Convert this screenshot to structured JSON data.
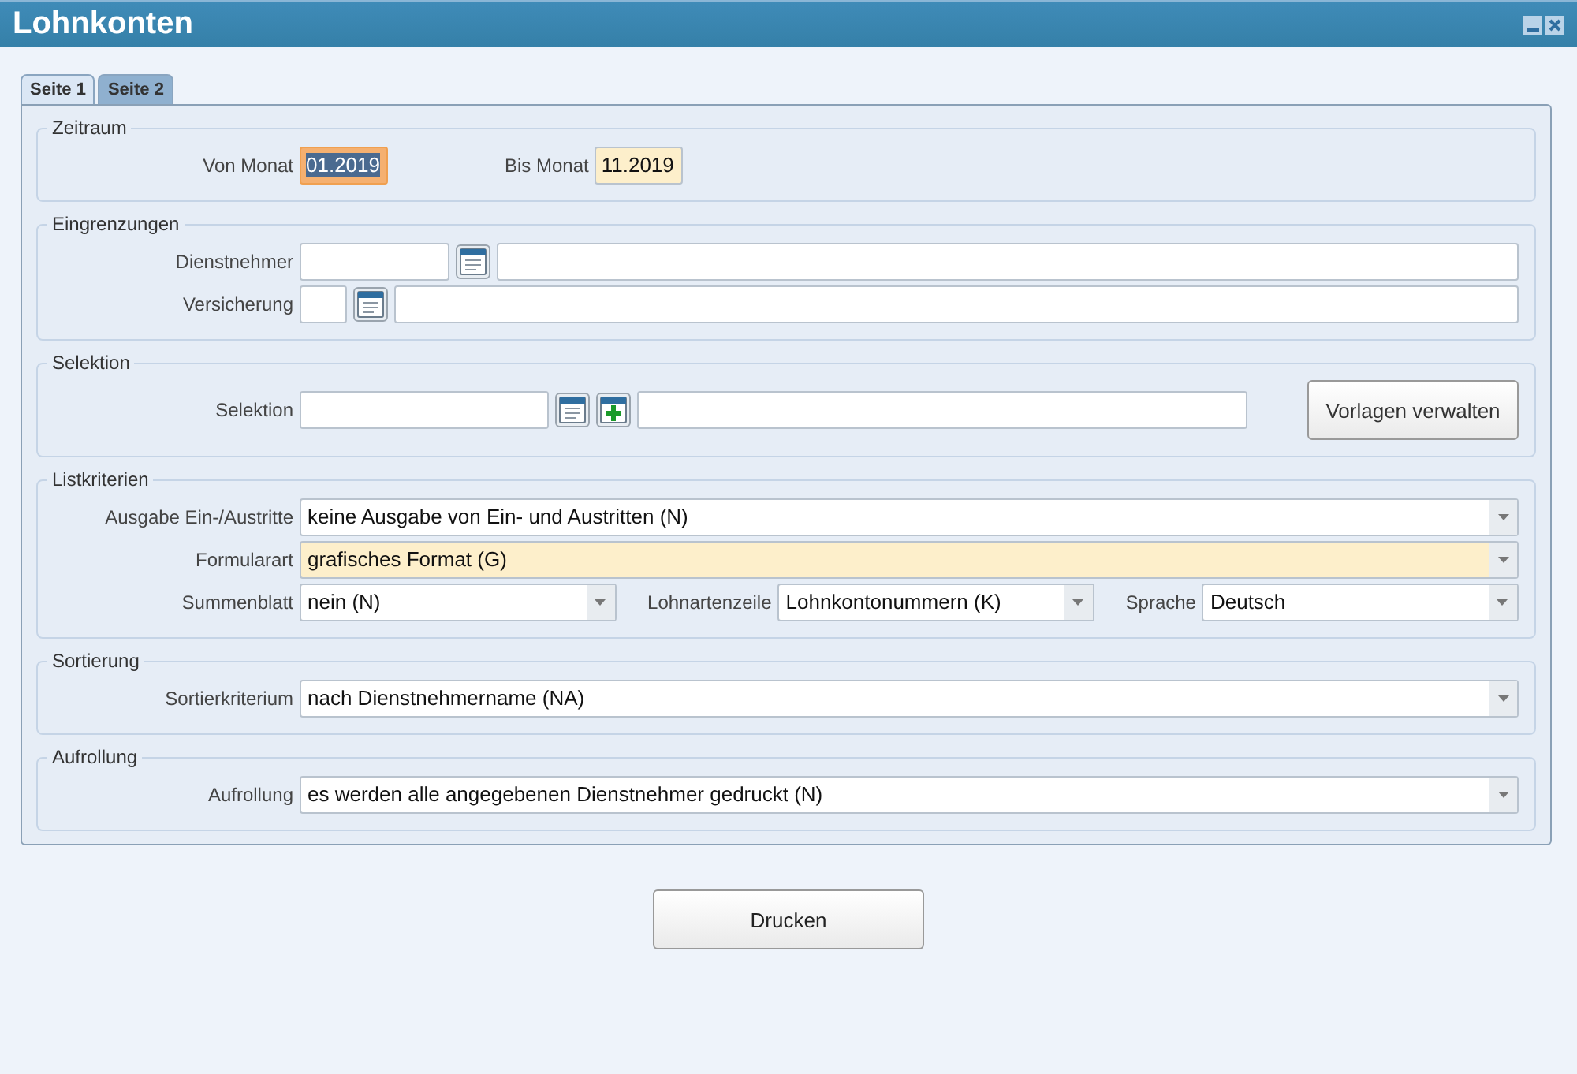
{
  "window": {
    "title": "Lohnkonten"
  },
  "tabs": [
    {
      "label": "Seite 1",
      "selected": true
    },
    {
      "label": "Seite 2",
      "selected": false
    }
  ],
  "sections": [
    {
      "title": "Zeitraum",
      "rows": [
        [
          {
            "kind": "label",
            "text": "Von Monat"
          },
          {
            "kind": "month-input",
            "value": "01.2019",
            "focused": true,
            "highlighted": false
          },
          {
            "kind": "inline-label",
            "text": "Bis Monat"
          },
          {
            "kind": "month-input",
            "value": "11.2019",
            "focused": false,
            "highlighted": true
          }
        ]
      ]
    },
    {
      "title": "Eingrenzungen",
      "rows": [
        [
          {
            "kind": "label",
            "text": "Dienstnehmer"
          },
          {
            "kind": "code-input",
            "focused": false,
            "highlighted": false
          },
          {
            "kind": "list-button"
          },
          {
            "kind": "name-input",
            "focused": false,
            "highlighted": false
          }
        ],
        [
          {
            "kind": "label",
            "text": "Versicherung"
          },
          {
            "kind": "key-input",
            "focused": false,
            "highlighted": false
          },
          {
            "kind": "list-button"
          },
          {
            "kind": "name-input",
            "focused": false,
            "highlighted": false
          }
        ]
      ]
    },
    {
      "title": "Selektion",
      "rows": [
        [
          {
            "kind": "label",
            "text": "Selektion"
          },
          {
            "kind": "selection-input",
            "focused": false,
            "highlighted": false
          },
          {
            "kind": "list-button"
          },
          {
            "kind": "add-button"
          },
          {
            "kind": "wide-input",
            "focused": false,
            "highlighted": false
          },
          {
            "kind": "button",
            "text": "Vorlagen verwalten"
          }
        ]
      ]
    },
    {
      "title": "Listkriterien",
      "rows": [
        [
          {
            "kind": "label",
            "text": "Ausgabe Ein-/Austritte"
          },
          {
            "kind": "dropdown",
            "value": "keine Ausgabe von Ein- und Austritten (N)",
            "focused": false,
            "highlighted": false
          }
        ],
        [
          {
            "kind": "label",
            "text": "Formularart"
          },
          {
            "kind": "dropdown",
            "value": "grafisches Format (G)",
            "focused": false,
            "highlighted": true
          }
        ],
        [
          {
            "kind": "label",
            "text": "Summenblatt"
          },
          {
            "kind": "dropdown",
            "value": "nein (N)",
            "focused": false,
            "highlighted": false
          },
          {
            "kind": "inline-label",
            "text": "Lohnartenzeile"
          },
          {
            "kind": "dropdown",
            "value": "Lohnkontonummern (K)",
            "focused": false,
            "highlighted": false
          },
          {
            "kind": "inline-label",
            "text": "Sprache"
          },
          {
            "kind": "dropdown",
            "value": "Deutsch",
            "focused": false,
            "highlighted": false
          }
        ]
      ]
    },
    {
      "title": "Sortierung",
      "rows": [
        [
          {
            "kind": "label",
            "text": "Sortierkriterium"
          },
          {
            "kind": "dropdown",
            "value": "nach Dienstnehmername (NA)",
            "focused": false,
            "highlighted": false
          }
        ]
      ]
    },
    {
      "title": "Aufrollung",
      "rows": [
        [
          {
            "kind": "label",
            "text": "Aufrollung"
          },
          {
            "kind": "dropdown",
            "value": "es werden alle angegebenen Dienstnehmer gedruckt (N)",
            "focused": false,
            "highlighted": false
          }
        ]
      ]
    }
  ],
  "print_button": {
    "label": "Drucken"
  }
}
